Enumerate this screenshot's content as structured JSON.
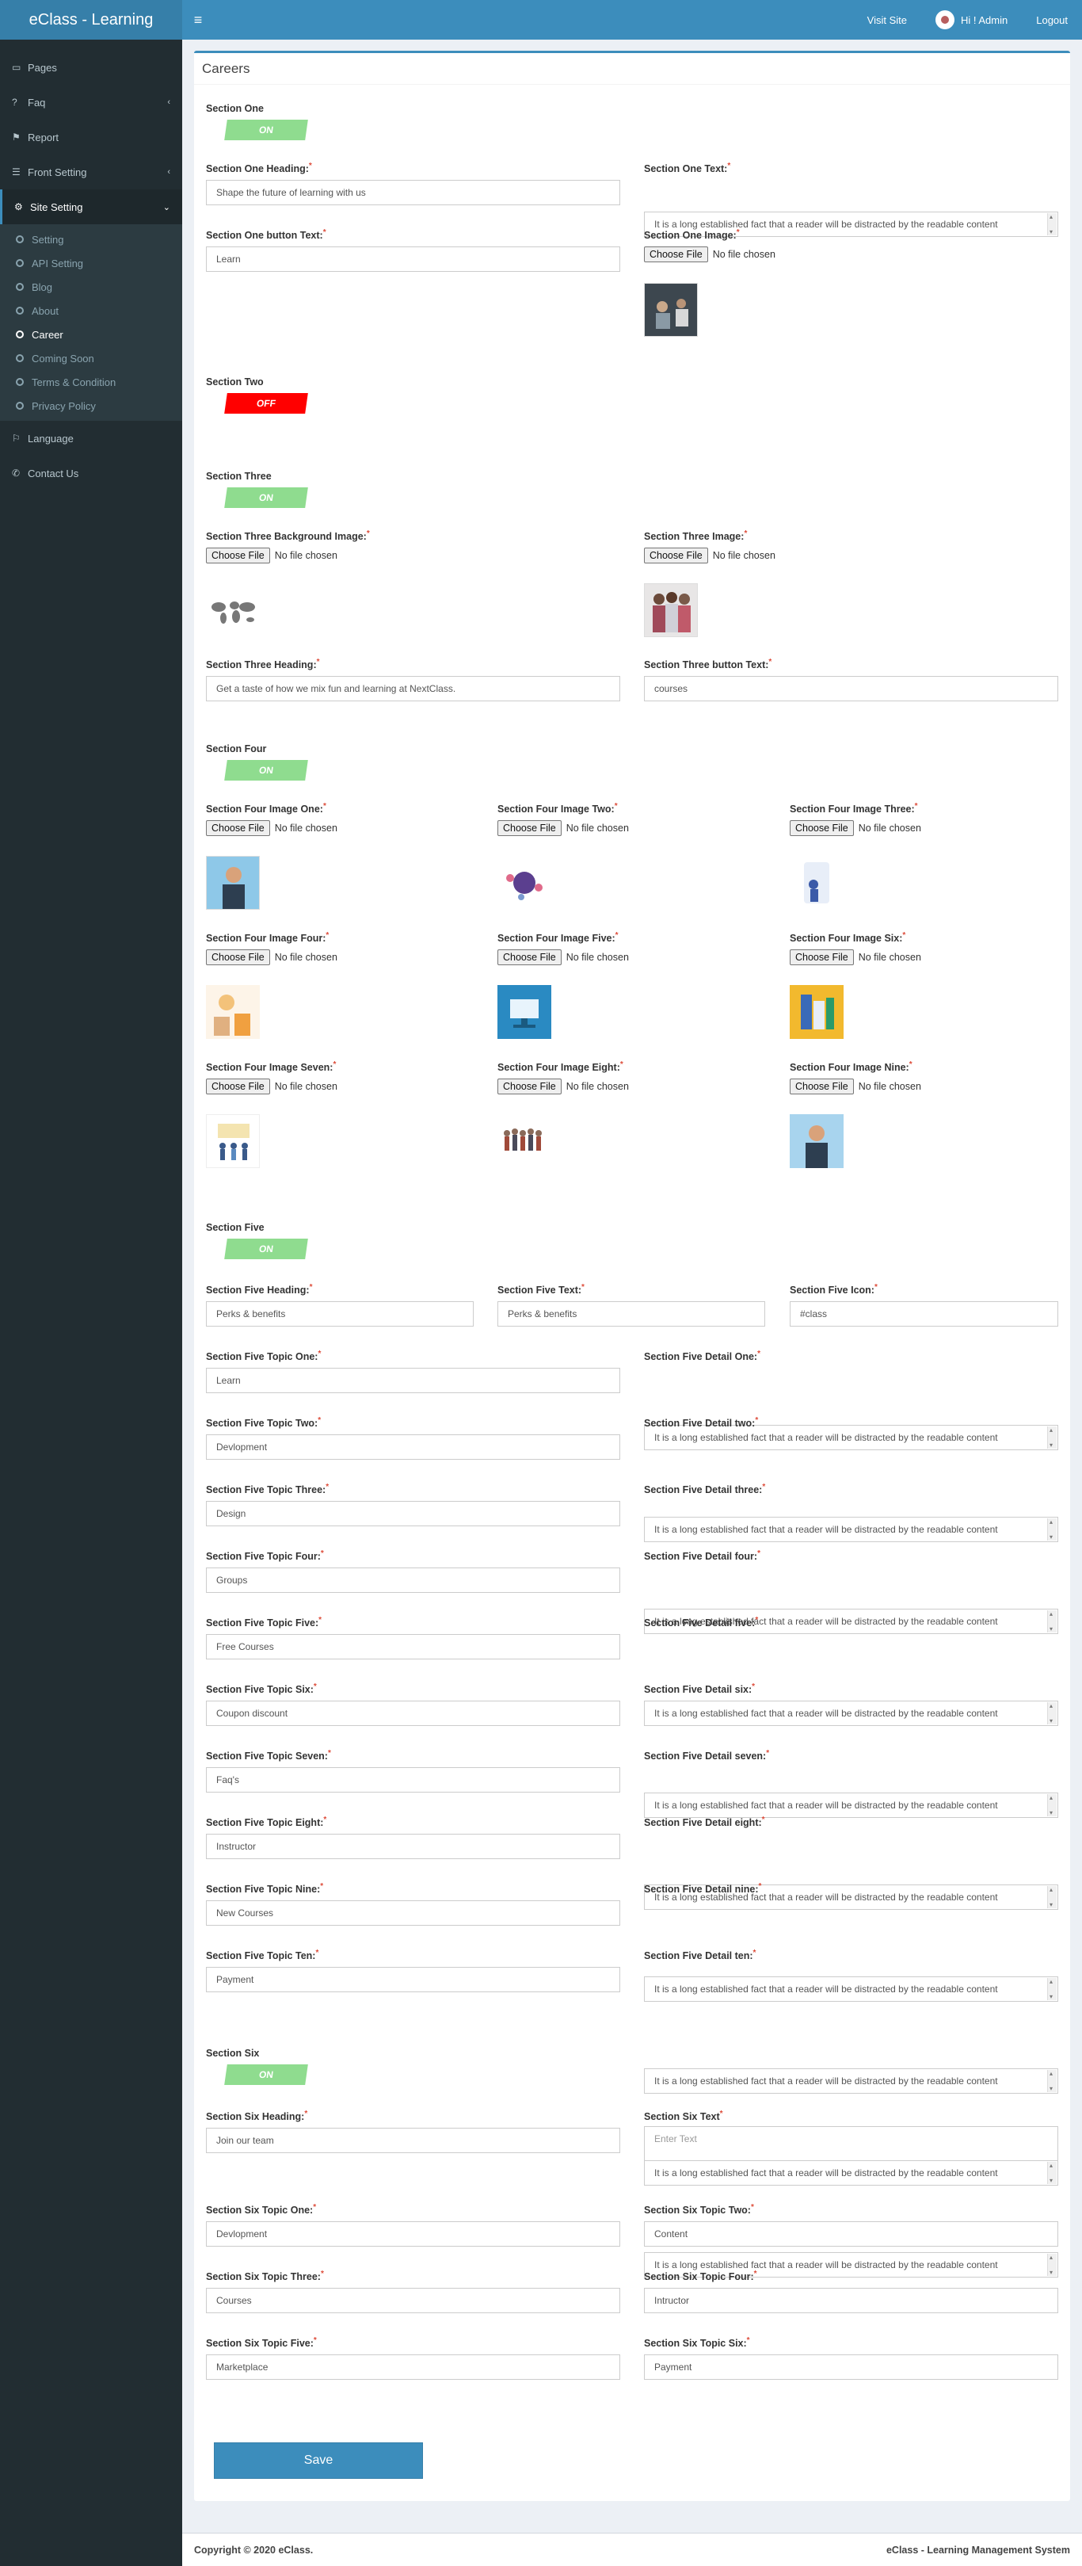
{
  "header": {
    "brand": "eClass - Learning",
    "visit_site": "Visit Site",
    "user": "Hi ! Admin",
    "logout": "Logout"
  },
  "sidebar": {
    "items": [
      {
        "label": "Pages"
      },
      {
        "label": "Faq"
      },
      {
        "label": "Report"
      },
      {
        "label": "Front Setting"
      },
      {
        "label": "Site Setting"
      }
    ],
    "submenu": [
      "Setting",
      "API Setting",
      "Blog",
      "About",
      "Career",
      "Coming Soon",
      "Terms & Condition",
      "Privacy Policy"
    ],
    "bottom": [
      {
        "label": "Language"
      },
      {
        "label": "Contact Us"
      }
    ]
  },
  "page": {
    "title": "Careers",
    "save": "Save"
  },
  "file_input": {
    "button": "Choose File",
    "status": "No file chosen"
  },
  "lorem": "It is a long established fact that a reader will be distracted by the readable content",
  "s1": {
    "title": "Section One",
    "toggle": "ON",
    "heading_label": "Section One Heading:",
    "heading_value": "Shape the future of learning with us",
    "text_label": "Section One Text:",
    "button_label": "Section One button Text:",
    "button_value": "Learn",
    "image_label": "Section One Image:"
  },
  "s2": {
    "title": "Section Two",
    "toggle": "OFF"
  },
  "s3": {
    "title": "Section Three",
    "toggle": "ON",
    "bg_label": "Section Three Background Image:",
    "image_label": "Section Three Image:",
    "heading_label": "Section Three Heading:",
    "heading_value": "Get a taste of how we mix fun and learning at NextClass.",
    "button_label": "Section Three button Text:",
    "button_value": "courses"
  },
  "s4": {
    "title": "Section Four",
    "toggle": "ON",
    "images": [
      "Section Four Image One:",
      "Section Four Image Two:",
      "Section Four Image Three:",
      "Section Four Image Four:",
      "Section Four Image Five:",
      "Section Four Image Six:",
      "Section Four Image Seven:",
      "Section Four Image Eight:",
      "Section Four Image Nine:"
    ]
  },
  "s5": {
    "title": "Section Five",
    "toggle": "ON",
    "heading_label": "Section Five Heading:",
    "heading_value": "Perks & benefits",
    "text_label": "Section Five Text:",
    "text_value": "Perks & benefits",
    "icon_label": "Section Five Icon:",
    "icon_value": "#class",
    "topics": [
      {
        "label": "Section Five Topic One:",
        "value": "Learn",
        "detail_label": "Section Five Detail One:"
      },
      {
        "label": "Section Five Topic Two:",
        "value": "Devlopment",
        "detail_label": "Section Five Detail two:"
      },
      {
        "label": "Section Five Topic Three:",
        "value": "Design",
        "detail_label": "Section Five Detail three:"
      },
      {
        "label": "Section Five Topic Four:",
        "value": "Groups",
        "detail_label": "Section Five Detail four:"
      },
      {
        "label": "Section Five Topic Five:",
        "value": "Free Courses",
        "detail_label": "Section Five Detail five:"
      },
      {
        "label": "Section Five Topic Six:",
        "value": "Coupon discount",
        "detail_label": "Section Five Detail six:"
      },
      {
        "label": "Section Five Topic Seven:",
        "value": "Faq's",
        "detail_label": "Section Five Detail seven:"
      },
      {
        "label": "Section Five Topic Eight:",
        "value": "Instructor",
        "detail_label": "Section Five Detail eight:"
      },
      {
        "label": "Section Five Topic Nine:",
        "value": "New Courses",
        "detail_label": "Section Five Detail nine:"
      },
      {
        "label": "Section Five Topic Ten:",
        "value": "Payment",
        "detail_label": "Section Five Detail ten:"
      }
    ]
  },
  "s6": {
    "title": "Section Six",
    "toggle": "ON",
    "heading_label": "Section Six Heading:",
    "heading_value": "Join our team",
    "text_label": "Section Six Text",
    "text_placeholder": "Enter Text",
    "topics": [
      {
        "label": "Section Six Topic One:",
        "value": "Devlopment"
      },
      {
        "label": "Section Six Topic Two:",
        "value": "Content"
      },
      {
        "label": "Section Six Topic Three:",
        "value": "Courses"
      },
      {
        "label": "Section Six Topic Four:",
        "value": "Intructor"
      },
      {
        "label": "Section Six Topic Five:",
        "value": "Marketplace"
      },
      {
        "label": "Section Six Topic Six:",
        "value": "Payment"
      }
    ]
  },
  "footer": {
    "copyright": "Copyright © 2020 eClass.",
    "system": "eClass - Learning Management System"
  },
  "colors": {
    "primary": "#3c8dbc",
    "sidebar": "#222d32",
    "toggle_on": "#8fdc8f",
    "toggle_off": "#ff0000"
  }
}
